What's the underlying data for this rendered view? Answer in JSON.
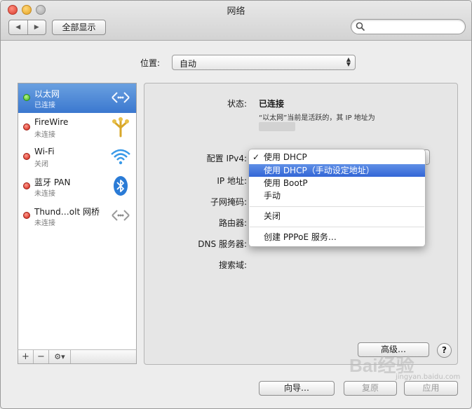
{
  "window": {
    "title": "网络"
  },
  "toolbar": {
    "back_label": "◀",
    "forward_label": "▶",
    "show_all_label": "全部显示",
    "search_placeholder": ""
  },
  "location": {
    "label": "位置:",
    "value": "自动"
  },
  "services": [
    {
      "name": "以太网",
      "status": "已连接",
      "state": "green",
      "icon": "ethernet-icon",
      "selected": true
    },
    {
      "name": "FireWire",
      "status": "未连接",
      "state": "red",
      "icon": "firewire-icon",
      "selected": false
    },
    {
      "name": "Wi-Fi",
      "status": "关闭",
      "state": "red",
      "icon": "wifi-icon",
      "selected": false
    },
    {
      "name": "蓝牙 PAN",
      "status": "未连接",
      "state": "red",
      "icon": "bluetooth-icon",
      "selected": false
    },
    {
      "name": "Thund…olt 网桥",
      "status": "未连接",
      "state": "red",
      "icon": "thunderbolt-bridge-icon",
      "selected": false
    }
  ],
  "list_bar": {
    "add": "+",
    "remove": "−",
    "gear": "⚙▾"
  },
  "detail": {
    "status_label": "状态:",
    "status_value": "已连接",
    "status_desc": "“以太网”当前是活跃的，其 IP 地址为",
    "configure_label": "配置 IPv4:",
    "ip_label": "IP 地址:",
    "subnet_label": "子网掩码:",
    "router_label": "路由器:",
    "dns_label": "DNS 服务器:",
    "search_domain_label": "搜索域:"
  },
  "ipv4_menu": {
    "items": [
      "使用 DHCP",
      "使用 DHCP（手动设定地址）",
      "使用 BootP",
      "手动",
      "关闭",
      "创建 PPPoE 服务…"
    ],
    "checked": "使用 DHCP",
    "highlighted": "使用 DHCP（手动设定地址）"
  },
  "buttons": {
    "advanced": "高级…",
    "help": "?",
    "assist": "向导…",
    "revert": "复原",
    "apply": "应用"
  },
  "watermark": {
    "text": "Bai经验",
    "url": "jingyan.baidu.com"
  }
}
